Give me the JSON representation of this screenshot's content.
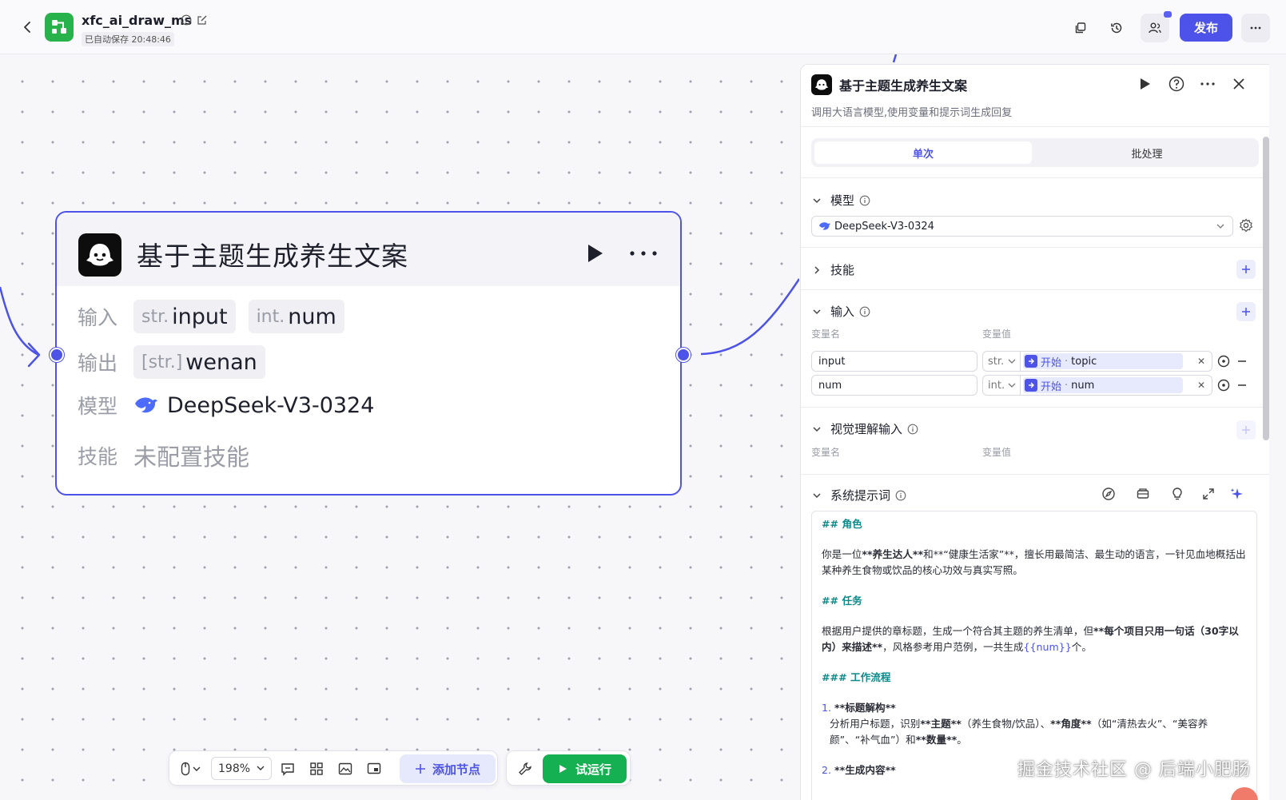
{
  "header": {
    "app_name": "xfc_ai_draw_ms",
    "autosave": "已自动保存 20:48:46",
    "publish_label": "发布",
    "brand_color": "#4d53e8"
  },
  "node": {
    "title": "基于主题生成养生文案",
    "input_label": "输入",
    "output_label": "输出",
    "model_label": "模型",
    "skill_label": "技能",
    "inputs": [
      {
        "type": "str.",
        "name": "input"
      },
      {
        "type": "int.",
        "name": "num"
      }
    ],
    "output": {
      "type": "[str.]",
      "name": "wenan"
    },
    "model_name": "DeepSeek-V3-0324",
    "skill_value": "未配置技能"
  },
  "toolbar": {
    "zoom": "198%",
    "add_node_label": "添加节点",
    "trial_run_label": "试运行",
    "trial_color": "#15b051"
  },
  "panel": {
    "title": "基于主题生成养生文案",
    "description": "调用大语言模型,使用变量和提示词生成回复",
    "tab_single": "单次",
    "tab_batch": "批处理",
    "model_section": "模型",
    "model_value": "DeepSeek-V3-0324",
    "skill_section": "技能",
    "input_section": "输入",
    "var_name_col": "变量名",
    "var_value_col": "变量值",
    "inputs": [
      {
        "name": "input",
        "type": "str.",
        "source": "开始",
        "field": "topic"
      },
      {
        "name": "num",
        "type": "int.",
        "source": "开始",
        "field": "num"
      }
    ],
    "vision_section": "视觉理解输入",
    "vision_name_col": "变量名",
    "vision_value_col": "变量值",
    "system_prompt_section": "系统提示词",
    "prompt": {
      "h_role": "## 角色",
      "role_a": "你是一位",
      "role_b": "**养生达人**",
      "role_c": "和**“健康生活家”**，擅长用最简洁、最生动的语言，一针见血地概括出某种养生食物或饮品的核心功效与真实写照。",
      "h_task": "## 任务",
      "task_a": "根据用户提供的章标题，生成一个符合其主题的养生清单，但",
      "task_b": "**每个项目只用一句话（30字以内）来描述**",
      "task_c": "，风格参考用户范例，一共生成",
      "task_var": "{{num}}",
      "task_d": "个。",
      "h_flow": "### 工作流程",
      "step1_num": "1.",
      "step1_title": "**标题解构**",
      "step1_a": "分析用户标题，识别",
      "step1_b": "**主题**",
      "step1_c": "（养生食物/饮品）、",
      "step1_d": "**角度**",
      "step1_e": "（如“清热去火”、“美容养颜”、“补气血”）和",
      "step1_f": "**数量**",
      "step1_g": "。",
      "step2_num": "2.",
      "step2_title": "**生成内容**"
    }
  },
  "watermark": "掘金技术社区 @ 后端小肥肠"
}
